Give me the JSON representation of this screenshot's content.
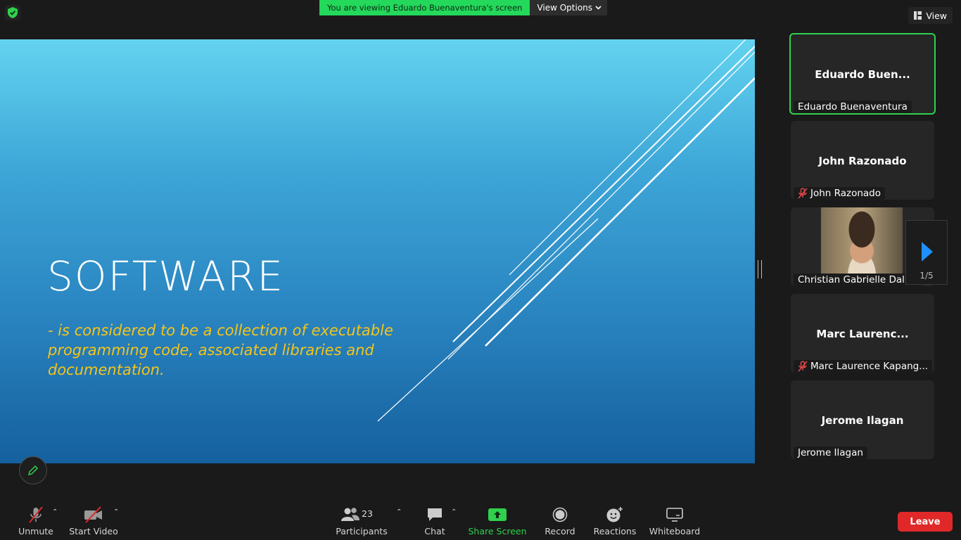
{
  "top": {
    "banner_text": "You are viewing Eduardo Buenaventura's screen",
    "view_options": "View Options",
    "view_button": "View"
  },
  "slide": {
    "title": "SOFTWARE",
    "body": "- is considered to be a collection of executable programming code, associated libraries and documentation.",
    "title_color": "#ffffff",
    "body_color": "#f5c518"
  },
  "participants": [
    {
      "big": "Eduardo Buen...",
      "tag": "Eduardo Buenaventura",
      "muted": false,
      "active": true
    },
    {
      "big": "John Razonado",
      "tag": "John Razonado",
      "muted": true,
      "active": false
    },
    {
      "big": "",
      "tag": "Christian Gabrielle Dalida",
      "muted": false,
      "active": false,
      "video": true
    },
    {
      "big": "Marc Laurenc...",
      "tag": "Marc Laurence Kapang...",
      "muted": true,
      "active": false
    },
    {
      "big": "Jerome Ilagan",
      "tag": "Jerome Ilagan",
      "muted": false,
      "active": false
    }
  ],
  "pager": {
    "text": "1/5"
  },
  "toolbar": {
    "unmute": "Unmute",
    "start_video": "Start Video",
    "participants": "Participants",
    "participant_count": "23",
    "chat": "Chat",
    "share_screen": "Share Screen",
    "record": "Record",
    "reactions": "Reactions",
    "whiteboard": "Whiteboard",
    "leave": "Leave"
  },
  "colors": {
    "accent_green": "#23d85a",
    "leave_red": "#e02828",
    "share_green": "#2fd14d"
  }
}
